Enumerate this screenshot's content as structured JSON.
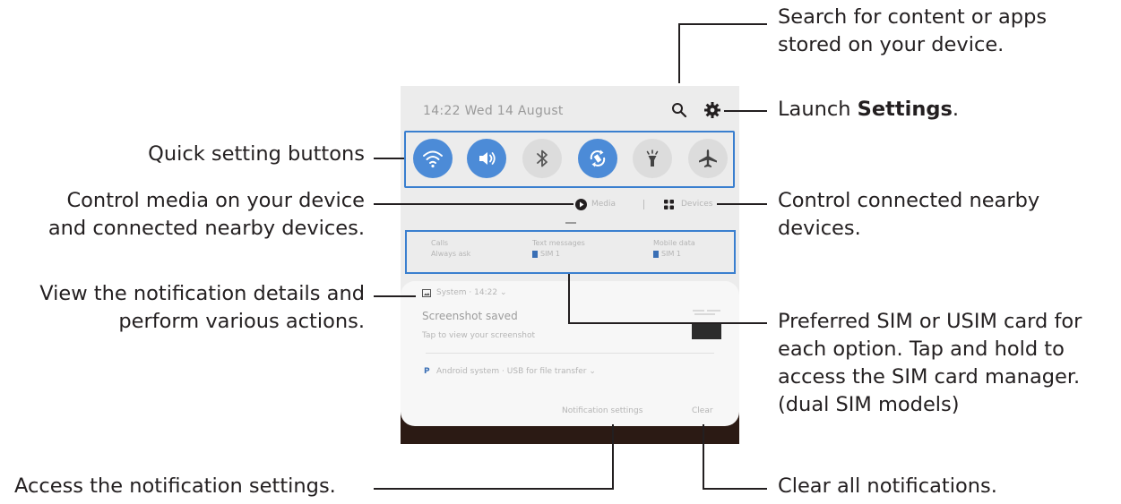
{
  "callouts": {
    "search_line1": "Search for content or apps",
    "search_line2": "stored on your device.",
    "settings_prefix": "Launch ",
    "settings_bold": "Settings",
    "settings_suffix": ".",
    "quick": "Quick setting buttons",
    "media_line1": "Control media on your device",
    "media_line2": "and connected nearby devices.",
    "devices_line1": "Control connected nearby",
    "devices_line2": "devices.",
    "notif_line1": "View the notification details and",
    "notif_line2": "perform various actions.",
    "sim_line1": "Preferred SIM or USIM card for",
    "sim_line2": "each option. Tap and hold to",
    "sim_line3": "access the SIM card manager.",
    "sim_line4": "(dual SIM models)",
    "notif_settings": "Access the notification settings.",
    "clear": "Clear all notifications."
  },
  "phone": {
    "clock": "14:22  Wed 14 August",
    "media_label": "Media",
    "devices_label": "Devices",
    "sim": [
      {
        "title": "Calls",
        "value": "Always ask"
      },
      {
        "title": "Text messages",
        "value": "SIM 1"
      },
      {
        "title": "Mobile data",
        "value": "SIM 1"
      }
    ],
    "notification": {
      "app": "System · 14:22 ⌄",
      "title": "Screenshot saved",
      "body": "Tap to view your screenshot",
      "system_row": "Android system · USB for file transfer ⌄"
    },
    "notif_settings_btn": "Notification settings",
    "clear_btn": "Clear"
  },
  "quick_settings": [
    {
      "name": "wifi-icon",
      "active": true
    },
    {
      "name": "sound-icon",
      "active": true
    },
    {
      "name": "bluetooth-icon",
      "active": false
    },
    {
      "name": "auto-rotate-icon",
      "active": true
    },
    {
      "name": "flashlight-icon",
      "active": false
    },
    {
      "name": "airplane-mode-icon",
      "active": false
    }
  ],
  "colors": {
    "accent": "#3a7fcf",
    "active_button": "#4c8bd7",
    "inactive_button": "#dcdcdc"
  }
}
